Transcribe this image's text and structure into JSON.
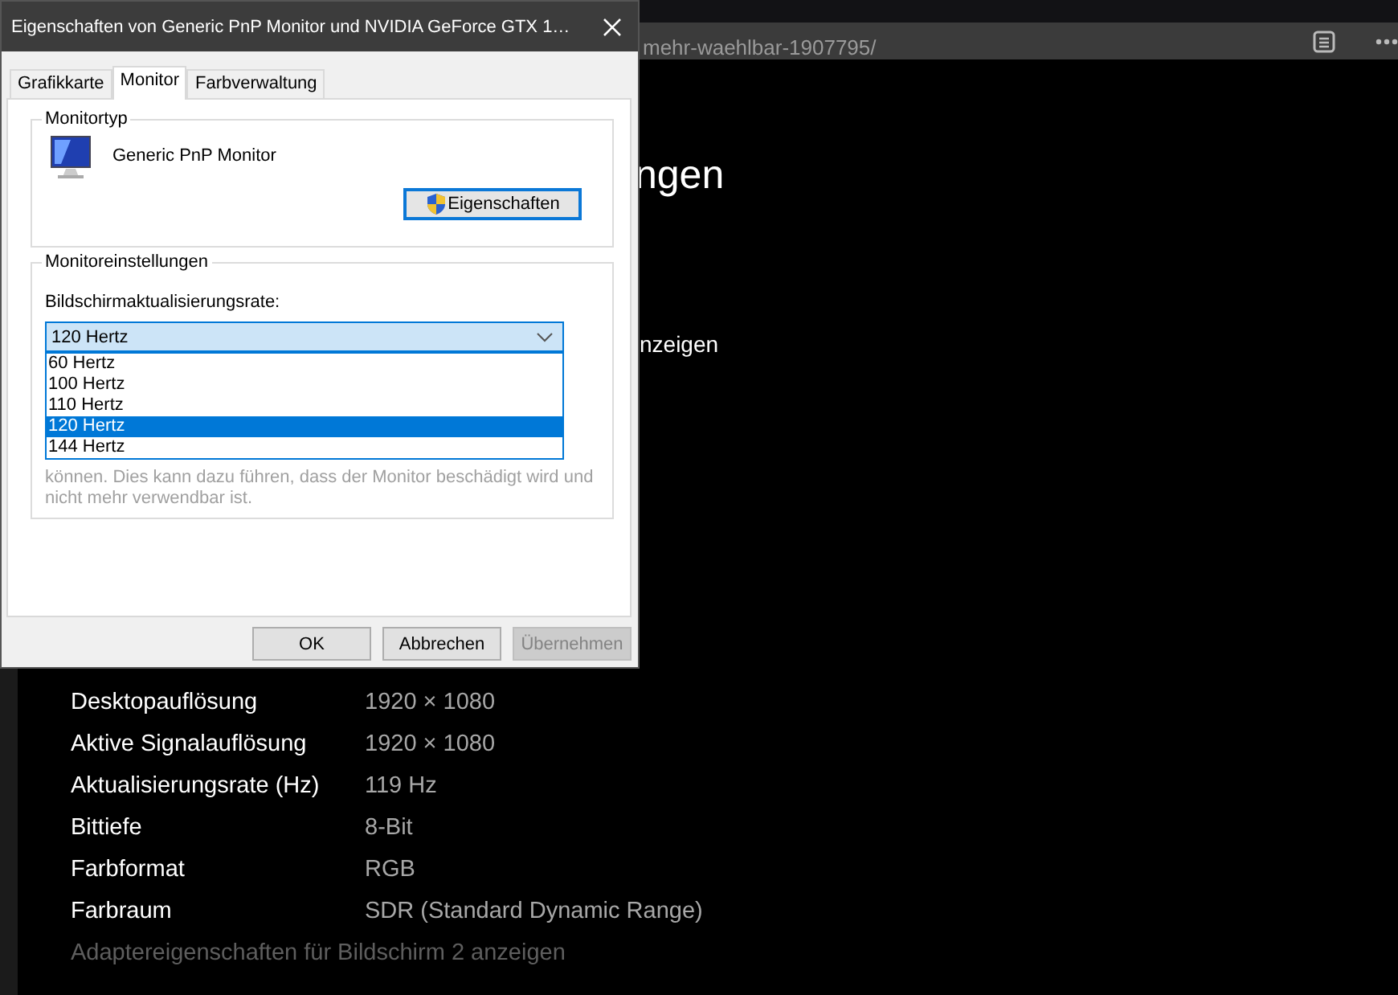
{
  "browser": {
    "url_fragment": "mehr-waehlbar-1907795/"
  },
  "settings_page": {
    "title_fragment": "ngen",
    "link_fragment": "nzeigen",
    "rows": [
      {
        "label": "Desktopauflösung",
        "value": "1920 × 1080"
      },
      {
        "label": "Aktive Signalauflösung",
        "value": "1920 × 1080"
      },
      {
        "label": "Aktualisierungsrate (Hz)",
        "value": "119 Hz"
      },
      {
        "label": "Bittiefe",
        "value": "8-Bit"
      },
      {
        "label": "Farbformat",
        "value": "RGB"
      },
      {
        "label": "Farbraum",
        "value": "SDR (Standard Dynamic Range)"
      }
    ],
    "adapter_link": "Adaptereigenschaften für Bildschirm 2 anzeigen"
  },
  "dialog": {
    "title": "Eigenschaften von Generic PnP Monitor und NVIDIA GeForce GTX 1…",
    "tabs": [
      {
        "label": "Grafikkarte",
        "selected": false
      },
      {
        "label": "Monitor",
        "selected": true
      },
      {
        "label": "Farbverwaltung",
        "selected": false
      }
    ],
    "monitor_type": {
      "legend": "Monitortyp",
      "name": "Generic PnP Monitor",
      "properties_button": "Eigenschaften"
    },
    "monitor_settings": {
      "legend": "Monitoreinstellungen",
      "rate_label": "Bildschirmaktualisierungsrate:",
      "rate_value": "120 Hertz",
      "dropdown_open": true,
      "options": [
        {
          "label": "60 Hertz",
          "selected": false
        },
        {
          "label": "100 Hertz",
          "selected": false
        },
        {
          "label": "110 Hertz",
          "selected": false
        },
        {
          "label": "120 Hertz",
          "selected": true
        },
        {
          "label": "144 Hertz",
          "selected": false
        }
      ],
      "warning_lines": [
        "können. Dies kann dazu führen, dass der Monitor beschädigt wird und",
        "nicht mehr verwendbar ist."
      ]
    },
    "buttons": [
      {
        "label": "OK",
        "disabled": false
      },
      {
        "label": "Abbrechen",
        "disabled": false
      },
      {
        "label": "Übernehmen",
        "disabled": true
      }
    ]
  }
}
